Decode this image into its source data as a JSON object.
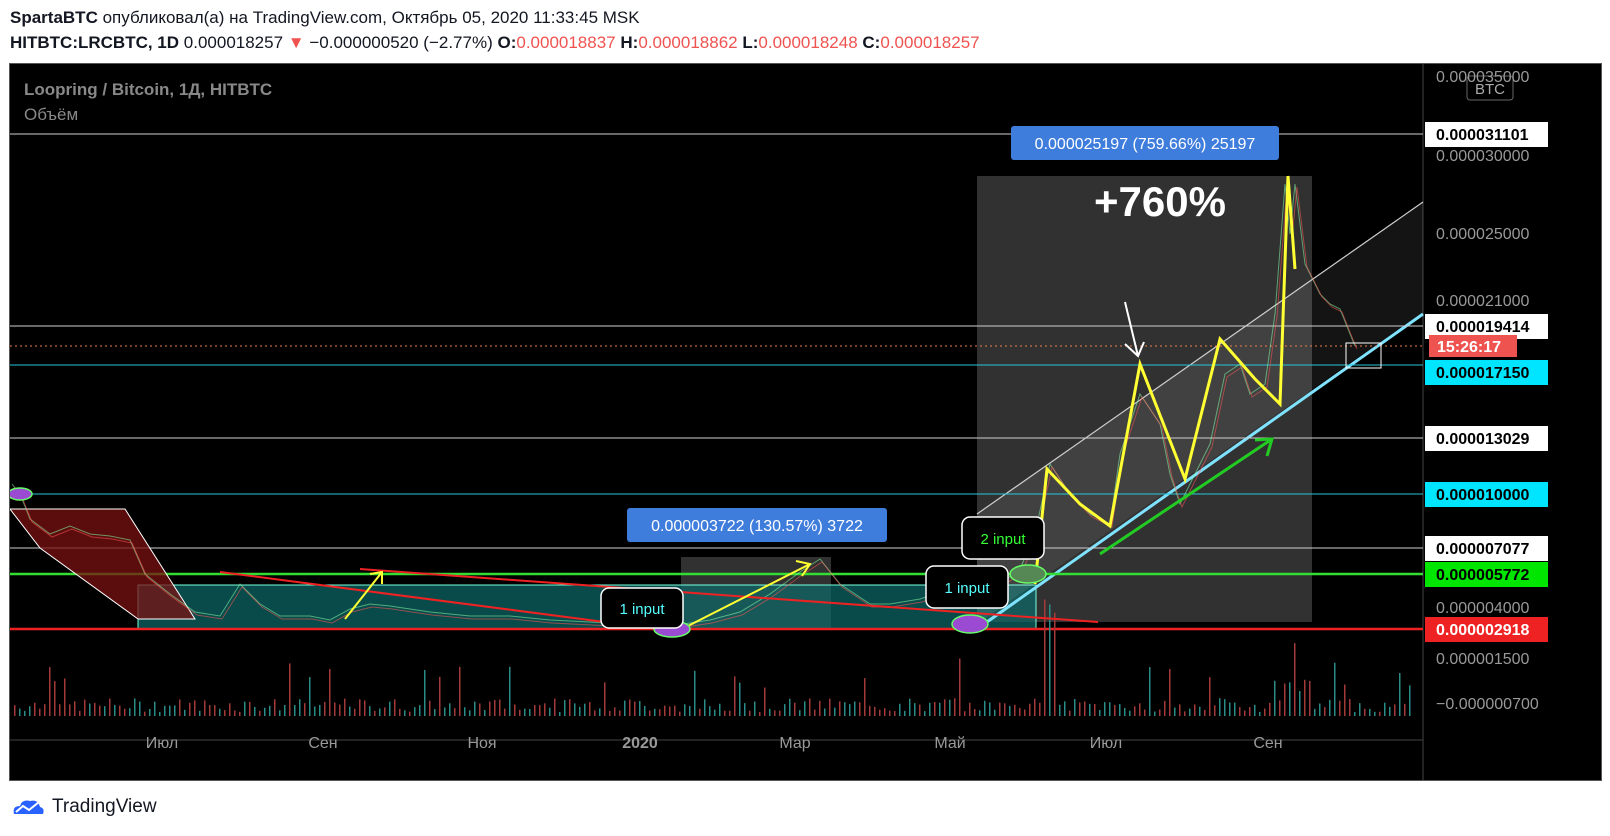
{
  "header": {
    "author": "SpartaBTC",
    "published_text": "опубликовал(а) на TradingView.com, Октябрь 05, 2020 11:33:45 MSK",
    "symbol": "HITBTC:LRCBTC, 1D",
    "last": "0.000018257",
    "change": "−0.000000520 (−2.77%)",
    "o_label": "O:",
    "o_value": "0.000018837",
    "h_label": "H:",
    "h_value": "0.000018862",
    "l_label": "L:",
    "l_value": "0.000018248",
    "c_label": "C:",
    "c_value": "0.000018257"
  },
  "chart": {
    "title": "Loopring / Bitcoin, 1Д, HITBTC",
    "volume_label": "Объём",
    "currency_badge": "BTC",
    "big_label": "+760%",
    "measure_big": "0.000025197 (759.66%) 25197",
    "measure_small": "0.000003722 (130.57%) 3722",
    "inputs": [
      "1 input",
      "1 input",
      "2 input"
    ],
    "countdown": "15:26:17",
    "price_labels": [
      {
        "text": "0.000035000",
        "kind": "axis"
      },
      {
        "text": "0.000031101",
        "kind": "line"
      },
      {
        "text": "0.000030000",
        "kind": "axis"
      },
      {
        "text": "0.000025000",
        "kind": "axis"
      },
      {
        "text": "0.000021000",
        "kind": "axis"
      },
      {
        "text": "0.000019414",
        "kind": "line"
      },
      {
        "text": "0.000017150",
        "kind": "cyan"
      },
      {
        "text": "0.000013029",
        "kind": "line"
      },
      {
        "text": "0.000010000",
        "kind": "cyan"
      },
      {
        "text": "0.000007077",
        "kind": "line"
      },
      {
        "text": "0.000005772",
        "kind": "green"
      },
      {
        "text": "0.000004000",
        "kind": "axis"
      },
      {
        "text": "0.000002918",
        "kind": "red"
      },
      {
        "text": "0.000001500",
        "kind": "axis"
      },
      {
        "text": "−0.000000700",
        "kind": "axis"
      }
    ],
    "time_labels": [
      "Июл",
      "Сен",
      "Ноя",
      "2020",
      "Мар",
      "Май",
      "Июл",
      "Сен"
    ]
  },
  "footer": {
    "brand": "TradingView"
  },
  "colors": {
    "red": "#ef5350",
    "cyan": "#00e5ff",
    "green": "#00e600",
    "blue_label": "#3f7ddc",
    "yellow": "#ffff33"
  }
}
